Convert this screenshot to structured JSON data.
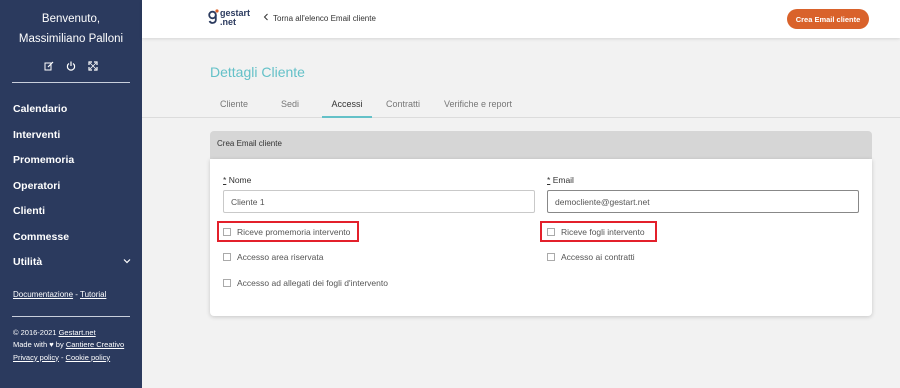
{
  "sidebar": {
    "welcome": "Benvenuto,",
    "user_name": "Massimiliano Palloni",
    "icons": [
      "edit-icon",
      "power-icon",
      "fullscreen-icon"
    ],
    "nav": [
      {
        "label": "Calendario"
      },
      {
        "label": "Interventi"
      },
      {
        "label": "Promemoria"
      },
      {
        "label": "Operatori"
      },
      {
        "label": "Clienti"
      },
      {
        "label": "Commesse"
      },
      {
        "label": "Utilità"
      }
    ],
    "doc_link": "Documentazione",
    "separator": " - ",
    "tutorial_link": "Tutorial",
    "footer": {
      "copyright": "© 2016-2021 ",
      "copyright_link": "Gestart.net",
      "made_with": "Made with ♥ by ",
      "made_with_link": "Cantiere Creativo",
      "privacy": "Privacy policy",
      "cookie": "Cookie policy"
    }
  },
  "topbar": {
    "logo_line1": "gestart",
    "logo_line2": ".net",
    "back_label": "Torna all'elenco Email cliente",
    "create_button": "Crea Email cliente",
    "accent_color": "#d9622b"
  },
  "page": {
    "title": "Dettagli Cliente",
    "tabs": [
      {
        "label": "Cliente"
      },
      {
        "label": "Sedi"
      },
      {
        "label": "Accessi"
      },
      {
        "label": "Contratti"
      },
      {
        "label": "Verifiche e report"
      }
    ],
    "active_tab": "Accessi",
    "title_color": "#64c1c8"
  },
  "form": {
    "header": "Crea Email cliente",
    "required_mark": "*",
    "nome_label": "Nome",
    "nome_value": "Cliente 1",
    "email_label": "Email",
    "email_value": "democliente@gestart.net",
    "checkboxes": {
      "promemoria": "Riceve promemoria intervento",
      "fogli": "Riceve fogli intervento",
      "area_riservata": "Accesso area riservata",
      "contratti": "Accesso ai contratti",
      "allegati": "Accesso ad allegati dei fogli d'intervento"
    }
  }
}
